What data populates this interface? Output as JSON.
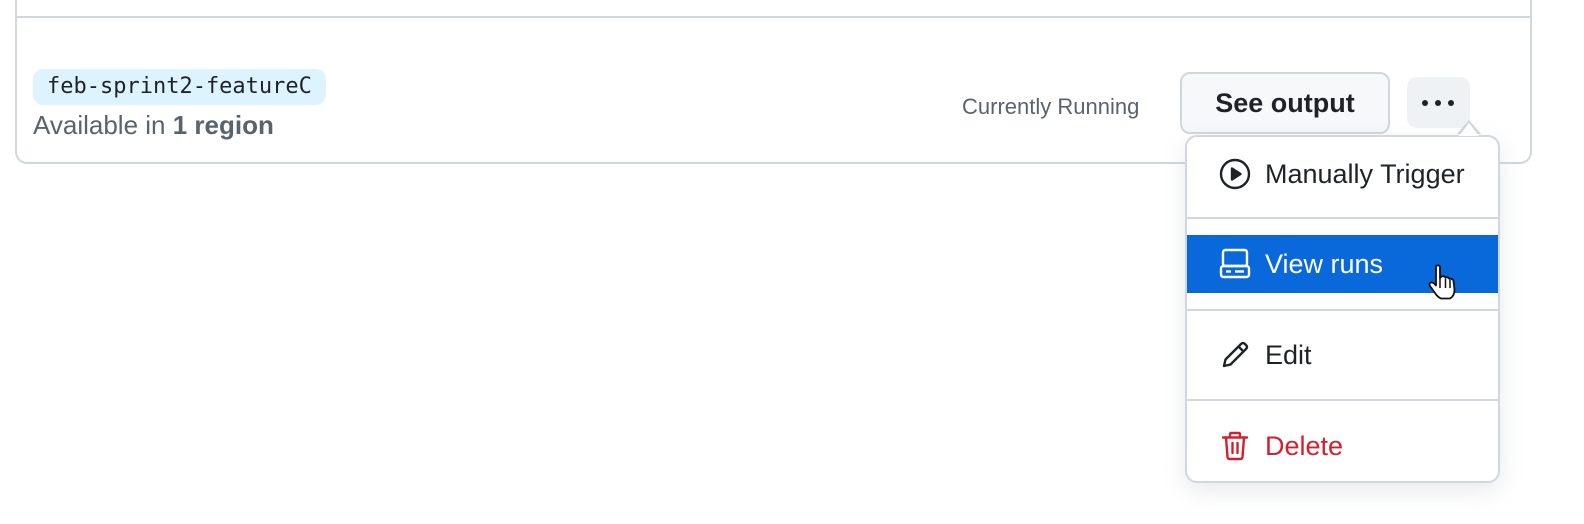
{
  "workflow": {
    "branch_name": "feb-sprint2-featureC",
    "availability_prefix": "Available in ",
    "availability_region": "1 region",
    "status": "Currently Running",
    "see_output_label": "See output"
  },
  "menu": {
    "items": [
      {
        "label": "Manually Trigger",
        "icon": "play-circle-icon",
        "state": "default"
      },
      {
        "label": "View runs",
        "icon": "server-icon",
        "state": "active"
      },
      {
        "label": "Edit",
        "icon": "pencil-icon",
        "state": "default"
      },
      {
        "label": "Delete",
        "icon": "trash-icon",
        "state": "danger"
      }
    ]
  },
  "colors": {
    "accent": "#0969da",
    "danger": "#cf222e",
    "tag_bg": "#ddf4ff",
    "border": "#d0d7de",
    "muted_text": "#59636e"
  }
}
